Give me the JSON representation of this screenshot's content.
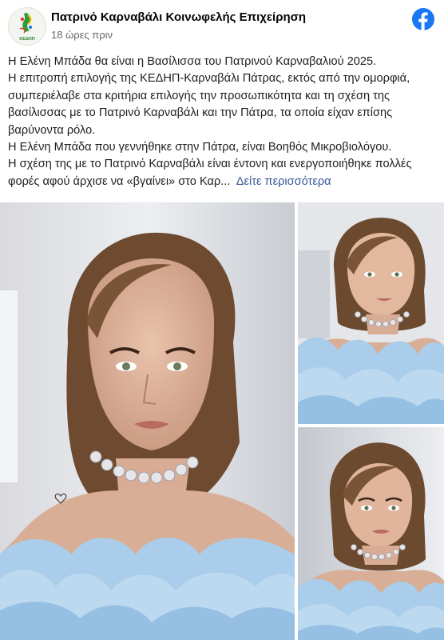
{
  "post": {
    "page_name": "Πατρινό Καρναβάλι Κοινωφελής Επιχείρηση",
    "time": "18 ώρες πριν",
    "avatar_text": "ΚΕΔΗΠ",
    "text_lines": [
      "Η Ελένη Μπάδα θα είναι η Βασίλισσα του Πατρινού Καρναβαλιού 2025.",
      "Η επιτροπή επιλογής της ΚΕΔΗΠ-Καρναβάλι Πάτρας, εκτός από την ομορφιά, συμπεριέλαβε στα κριτήρια επιλογής την προσωπικότητα και τη σχέση της βασίλισσας με το Πατρινό Καρναβάλι και την Πάτρα, τα οποία είχαν επίσης βαρύνοντα ρόλο.",
      "Η Ελένη Μπάδα που γεννήθηκε στην Πάτρα, είναι Βοηθός Μικροβιολόγου.",
      "Η σχέση της με το Πατρινό Καρναβάλι είναι έντονη και ενεργοποιήθηκε πολλές φορές αφού άρχισε να «βγαίνει» στο Καρ..."
    ],
    "see_more": "Δείτε περισσότερα"
  },
  "icons": {
    "brand": "facebook-icon",
    "avatar": "carnival-logo-icon"
  },
  "colors": {
    "facebook_blue": "#1877f2",
    "link": "#385898",
    "dress": "#a9cdea",
    "hair": "#6b4a30"
  }
}
